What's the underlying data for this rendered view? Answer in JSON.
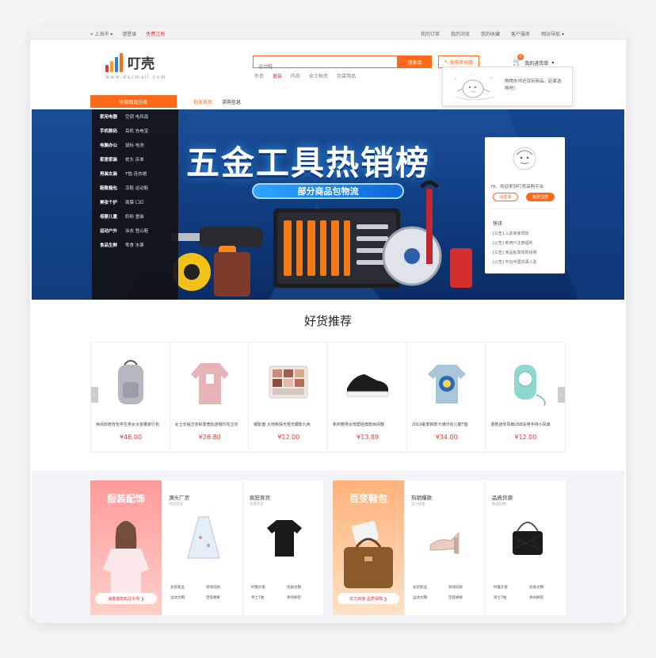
{
  "topbar": {
    "location": "上海市",
    "login": "请登录",
    "register": "免费注册",
    "right_links": [
      "我的订单",
      "我的浏览",
      "我的收藏",
      "客户服务",
      "网站导航"
    ]
  },
  "logo": {
    "name": "叮壳",
    "domain": "www.dacmall.com"
  },
  "search": {
    "placeholder": "运动鞋",
    "button": "搜索品",
    "release_button": "发布手机单",
    "hot_words": [
      "外衣",
      "童装",
      "内衣",
      "女士秋衣",
      "包袋用品"
    ]
  },
  "cart": {
    "label": "我的进货单",
    "count": "0",
    "popup_text": "购物车中还没有商品，赶紧选购吧！"
  },
  "category_header": "全部商品分类",
  "nav": [
    "批发首页",
    "求购信息"
  ],
  "categories": [
    {
      "name": "家用电器",
      "subs": "空调  电风扇"
    },
    {
      "name": "手机数码",
      "subs": "耳机  充电宝"
    },
    {
      "name": "电脑办公",
      "subs": "鼠标  电池"
    },
    {
      "name": "家居家装",
      "subs": "枕头  床单"
    },
    {
      "name": "男装女装",
      "subs": "T恤  连衣裙"
    },
    {
      "name": "鞋靴箱包",
      "subs": "凉鞋  运动鞋"
    },
    {
      "name": "美妆个护",
      "subs": "面膜  口红"
    },
    {
      "name": "母婴儿童",
      "subs": "奶粉  童装"
    },
    {
      "name": "运动户外",
      "subs": "泳衣  登山鞋"
    },
    {
      "name": "食品生鲜",
      "subs": "零食  水果"
    }
  ],
  "banner": {
    "title": "五金工具热销榜",
    "subtitle": "部分商品包物流"
  },
  "welcome": {
    "greeting": "Hi，欢迎来到叮壳采购平台",
    "login": "请登录",
    "register": "免费注册",
    "news_title": "快讯",
    "news": [
      "[公告]  入驻商家须知",
      "[公告]  新用户注册福利",
      "[公告]  商品批发规则说明",
      "[公告]  平台中国货源入驻"
    ]
  },
  "section_title": "好货推荐",
  "products": [
    {
      "title": "休闲双肩背包学生男女大容量旅行包",
      "price": "¥46.00"
    },
    {
      "title": "女士长袖卫衣秋季宽松连帽印花卫衣",
      "price": "¥26.80"
    },
    {
      "title": "眼影盘 大地色珠光哑光眼影九色",
      "price": "¥12.00"
    },
    {
      "title": "帆布鞋男女低帮经典款休闲鞋",
      "price": "¥13.89"
    },
    {
      "title": "2019夏季新款卡通印花儿童T恤",
      "price": "¥34.00"
    },
    {
      "title": "便携迷你风扇USB充电手持小风扇",
      "price": "¥12.00"
    }
  ],
  "floors": [
    {
      "promo_title": "服装配饰",
      "promo_pill": "海量爆款新品专场 ❯",
      "cols": [
        {
          "title": "源头厂货",
          "sub": "淘宝热卖",
          "links": [
            "女装新品",
            "商场同款",
            "运动文胸",
            "百搭裙裤"
          ]
        },
        {
          "title": "疯狂背货",
          "sub": "货源充足",
          "links": [
            "时髦外套",
            "优质文胸",
            "男士T恤",
            "休闲裤装"
          ]
        }
      ]
    },
    {
      "promo_title": "百变鞋包",
      "promo_pill": "实力商家 品质保障 ❯",
      "cols": [
        {
          "title": "热销爆款",
          "sub": "实力商家",
          "links": [
            "女装新品",
            "商场同款",
            "运动文胸",
            "百搭裙裤"
          ]
        },
        {
          "title": "品质货源",
          "sub": "甄选好物",
          "links": [
            "时髦外套",
            "优质文胸",
            "男士T恤",
            "休闲裤装"
          ]
        }
      ]
    }
  ],
  "colors": {
    "accent": "#ff6a1a",
    "price": "#e4393c"
  }
}
